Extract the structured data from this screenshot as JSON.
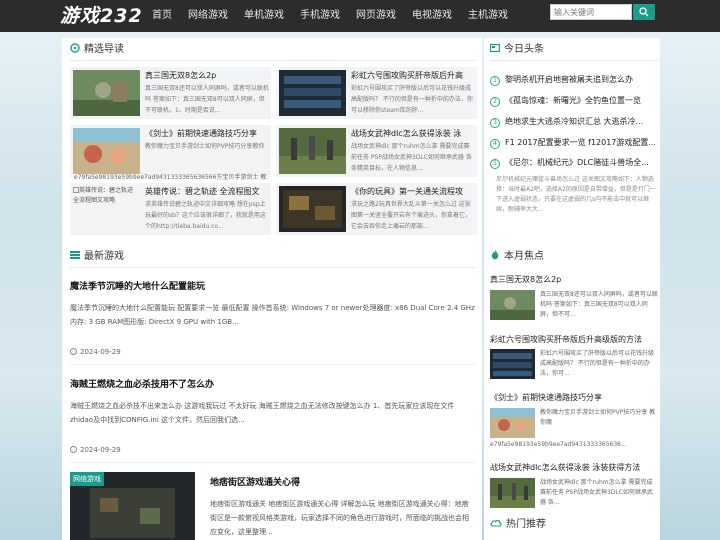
{
  "header": {
    "logo": "游戏232",
    "nav": [
      "首页",
      "网络游戏",
      "单机游戏",
      "手机游戏",
      "网页游戏",
      "电视游戏",
      "主机游戏"
    ],
    "search_placeholder": "输入关键词"
  },
  "featured": {
    "heading": "精选导读",
    "items": [
      {
        "title": "真三国无双8怎么2p",
        "desc": "真三国无双8还可以双人同屏吗，或者可以联机吗 答案如下：真三国无双8可以双人同屏，但不可联机。1、时期是否说..."
      },
      {
        "title": "彩虹六号围攻购买肝帝版后升高",
        "desc": "彩虹六号围攻买了肝帝版以后可以花钱升级成高配版吗？ 不行的但是有一种折中的办法，你可以移除你steam库的肝..."
      },
      {
        "title": "《剑士》前期快速通路技巧分享",
        "desc": "教你魔力宝贝手游剑士如何PVP技巧分享教你魔",
        "img_alt": "e79fa5e98193e59b9ee7ad9431333365636566方宝贝手游剑士 教..."
      },
      {
        "title": "战场女武神dlc怎么获得泳装 泳",
        "desc": "战场女武神dlc 那个ruhm怎么拿 需要完成赛前任务 PSP战场女武神3DLC如何继承武器 各条精英目标，在人物信息..."
      },
      {
        "title": "英雄传说：碧之轨迹 全流程图文",
        "desc": "求英雄传说碧之轨迹中文详细攻略 想在psp上玩最好的sb？这个应该很详细了，我就是用这个的http://tieba.baidu.co...",
        "img_alt": "英雄传说：碧之轨迹 全流程图文攻略"
      },
      {
        "title": "《你的玩具》第一关通关流程攻",
        "desc": "求玩之路2玩具世界大乱斗第一关怎么过 这张图第一关竖全覆开岩有个痕迹头，你拿着它，它会去吞你走上痛岩的那部..."
      }
    ]
  },
  "latest": {
    "heading": "最新游戏",
    "items": [
      {
        "title": "魔法季节沉睡的大地什么配置能玩",
        "desc": "魔法季节沉睡的大地什么配置能玩 配置要求一览 最低配置 操作首系统: Windows 7 or newer处理器度: x86 Dual Core 2.4 GHz内存: 3 GB RAM图形版: DirectX 9 GPU with 1GB...",
        "date": "2024-09-29"
      },
      {
        "title": "海贼王燃烧之血必杀技用不了怎么办",
        "desc": "海贼王燃烧之血必杀技不出来怎么办 这游戏我玩过 不太好玩 海贼王燃烧之血无法修改按键怎么办 1、首先玩家应该现在文件zhidao及中找到CONFIG.ini 这个文件，然后回我们选...",
        "date": "2024-09-29"
      },
      {
        "title": "地痞街区游戏通关心得",
        "desc": "地痞街区游戏通关 地痞街区游戏通关心得 详解怎么玩 地痞街区游戏通关心得：地痞街区是一款俯视风格类游戏，玩家选择不同的角色进行游戏时，所面临的挑战也会相应变化，这里整理...",
        "tag": "网络游戏"
      }
    ]
  },
  "headlines": {
    "heading": "今日头条",
    "items": [
      "黎明杀机开启地窖被屠夫追到怎么办",
      "《孤岛惊魂：新曙光》全钓鱼位置一览",
      "绝地求生大逃杀冷知识汇总 大逃杀冷...",
      "F1 2017配置要求一览 f12017游戏配置...",
      "《尼尔：机械纪元》DLC赌徒斗兽场全..."
    ],
    "desc": "尼尔机械纪元赌徒斗兽场怎么过 这关图文攻略如下：人物选择：当时最A2吧，选择A2的原因是自带增益，但是是打门一下进入虚弱状态，只要在这虚弱的几s内不能击中就可以继续，耐辅率大大..."
  },
  "monthly": {
    "heading": "本月焦点",
    "items": [
      {
        "title": "真三国无双8怎么2p",
        "desc": "真三国无双8还可以双人同屏吗，或者可以联机吗 答案如下：真三国无双8可以双人同屏，但不可..."
      },
      {
        "title": "彩虹六号围攻购买肝帝版后升高级版的方法",
        "desc": "彩虹六号围攻买了肝帝版以后可以花钱升级成高配版吗？ 不行的但是有一种折中的办法，你可..."
      },
      {
        "title": "《剑士》前期快速通路技巧分享",
        "desc": "教你魔力宝贝手游剑士如何PVP技巧分享 教你魔",
        "img_alt": "e79fa5e98193e59b9ee7ad9431333365636..."
      },
      {
        "title": "战场女武神dlc怎么获得泳装 泳装获得方法",
        "desc": "战场女武神dlc 那个ruhm怎么拿 需要完成赛前任务 PSP战场女武神3DLC如何继承武器 各..."
      }
    ]
  },
  "hot": {
    "heading": "热门推荐"
  },
  "colors": {
    "accent": "#1b9c8b",
    "topbar": "#2c2c2c"
  }
}
